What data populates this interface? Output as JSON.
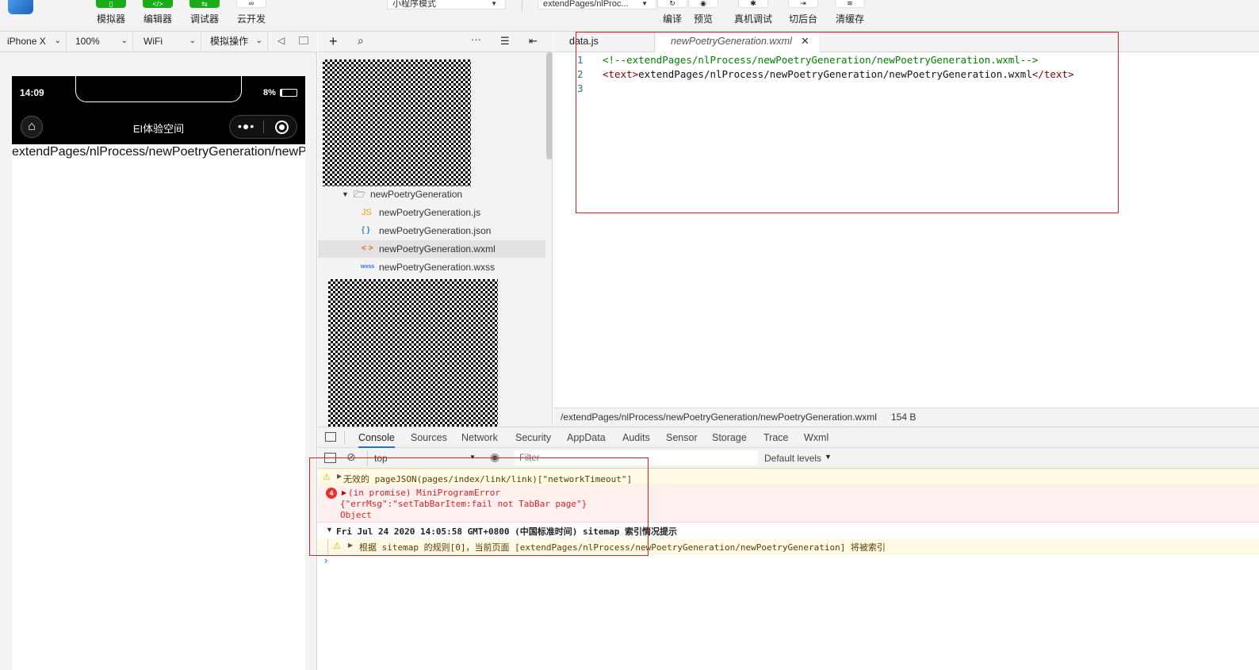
{
  "toolbar": {
    "buttons": [
      {
        "label": "模拟器"
      },
      {
        "label": "编辑器"
      },
      {
        "label": "调试器"
      },
      {
        "label": "云开发"
      }
    ],
    "mode_select": "小程序模式",
    "compile_select": "extendPages/nlProc...",
    "actions": [
      {
        "label": "编译"
      },
      {
        "label": "预览"
      },
      {
        "label": "真机调试"
      },
      {
        "label": "切后台"
      },
      {
        "label": "清缓存"
      }
    ]
  },
  "simulator_bar": {
    "device": "iPhone X",
    "zoom": "100%",
    "network": "WiFi",
    "operation": "模拟操作"
  },
  "phone": {
    "time": "14:09",
    "battery": "8%",
    "nav_title": "EI体验空间",
    "page_text": "extendPages/nlProcess/newPoetryGeneration/newPoetryGeneration.wxml"
  },
  "file_tree": {
    "folder": "newPoetryGeneration",
    "files": [
      {
        "icon": "JS",
        "name": "newPoetryGeneration.js",
        "color": "#e6a700"
      },
      {
        "icon": "{ }",
        "name": "newPoetryGeneration.json",
        "color": "#2b88d8"
      },
      {
        "icon": "< >",
        "name": "newPoetryGeneration.wxml",
        "color": "#e8601c"
      },
      {
        "icon": "wxss",
        "name": "newPoetryGeneration.wxss",
        "color": "#2b6fd8"
      }
    ]
  },
  "editor": {
    "tabs": [
      {
        "label": "data.js"
      },
      {
        "label": "newPoetryGeneration.wxml"
      }
    ],
    "lines": [
      {
        "num": "1",
        "comment": "<!--extendPages/nlProcess/newPoetryGeneration/newPoetryGeneration.wxml-->"
      },
      {
        "num": "2",
        "open": "<text>",
        "text": "extendPages/nlProcess/newPoetryGeneration/newPoetryGeneration.wxml",
        "close": "</text>"
      },
      {
        "num": "3"
      }
    ],
    "status_path": "/extendPages/nlProcess/newPoetryGeneration/newPoetryGeneration.wxml",
    "status_size": "154 B"
  },
  "devtools": {
    "tabs": [
      "Console",
      "Sources",
      "Network",
      "Security",
      "AppData",
      "Audits",
      "Sensor",
      "Storage",
      "Trace",
      "Wxml"
    ],
    "context": "top",
    "filter_placeholder": "Filter",
    "levels": "Default levels",
    "messages": {
      "warn1": "无效的 pageJSON(pages/index/link/link)[\"networkTimeout\"]",
      "error_count": "4",
      "error_line1": "(in promise) MiniProgramError",
      "error_line2": "{\"errMsg\":\"setTabBarItem:fail not TabBar page\"}",
      "error_line3": "Object",
      "group": "Fri Jul 24 2020 14:05:58 GMT+0800 (中国标准时间) sitemap 索引情况提示",
      "warn2": "根据 sitemap 的规则[0]，当前页面 [extendPages/nlProcess/newPoetryGeneration/newPoetryGeneration] 将被索引"
    }
  }
}
